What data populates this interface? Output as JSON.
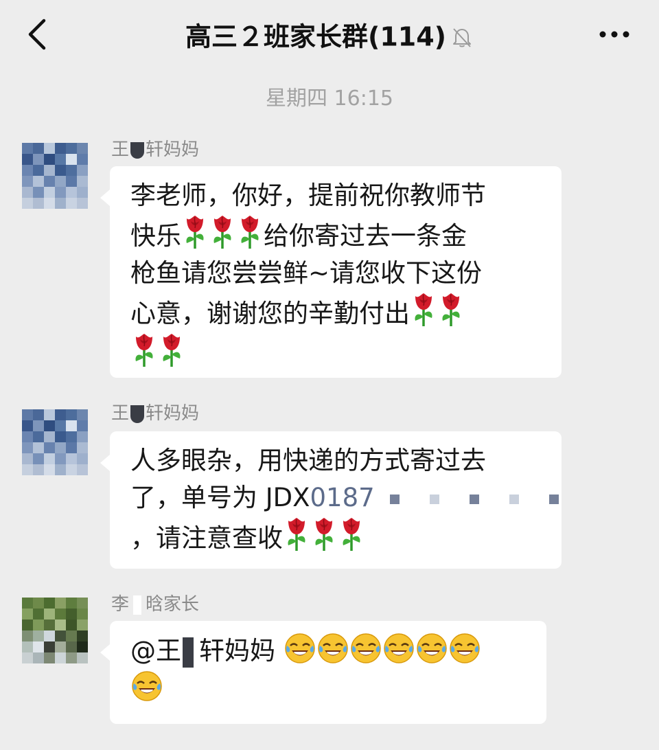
{
  "header": {
    "title": "高三２班家长群(114)",
    "back_icon": "chevron-left-icon",
    "mute_icon": "bell-slash-icon",
    "more_icon": "more-dots-icon"
  },
  "timestamp": "星期四 16:15",
  "messages": [
    {
      "sender_prefix": "王",
      "sender_suffix": "轩妈妈",
      "lines": [
        "李老师，你好，提前祝你教师节",
        "快乐",
        "给你寄过去一条金",
        "枪鱼请您尝尝鲜~请您收下这份",
        "心意，谢谢您的辛勤付出"
      ],
      "emoji": "rose-emoji"
    },
    {
      "sender_prefix": "王",
      "sender_suffix": "轩妈妈",
      "lines": [
        "人多眼杂，用快递的方式寄过去",
        "了，单号为 JDX",
        "0187",
        "，请注意查收"
      ],
      "emoji": "rose-emoji"
    },
    {
      "sender_prefix": "李",
      "sender_suffix": "晗家长",
      "mention_prefix": "@王",
      "mention_suffix": "轩妈妈",
      "emoji": "tears-of-joy-emoji"
    }
  ],
  "colors": {
    "background": "#ededed",
    "bubble": "#ffffff",
    "timestamp": "#a2a2a2",
    "sender": "#8a8a8a"
  }
}
